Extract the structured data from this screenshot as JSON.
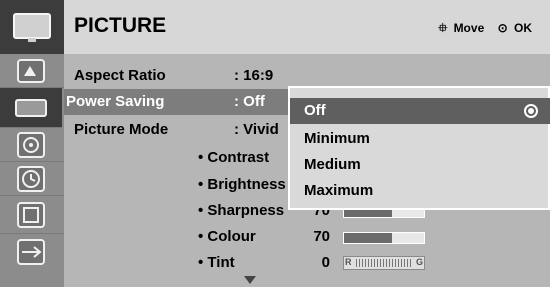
{
  "header": {
    "title": "PICTURE",
    "move_symbol": "⯐",
    "move_label": "Move",
    "ok_symbol": "⊙",
    "ok_label": "OK"
  },
  "sidebar": {
    "icons": [
      "picture-icon",
      "tv-icon",
      "audio-icon",
      "time-icon",
      "option-icon",
      "input-icon"
    ]
  },
  "menu": {
    "rows": [
      {
        "label": "Aspect Ratio",
        "value": ": 16:9"
      },
      {
        "label": "Power Saving",
        "value": ": Off"
      },
      {
        "label": "Picture Mode",
        "value": ": Vivid"
      }
    ],
    "sub_rows": [
      {
        "label": "• Contrast",
        "value": "",
        "level": null
      },
      {
        "label": "• Brightness",
        "value": "",
        "level": null
      },
      {
        "label": "• Sharpness",
        "value": "70",
        "level": 0.6
      },
      {
        "label": "• Colour",
        "value": "70",
        "level": 0.6
      },
      {
        "label": "• Tint",
        "value": "0",
        "tint_left": "R",
        "tint_right": "G"
      }
    ]
  },
  "dropdown": {
    "options": [
      "Off",
      "Minimum",
      "Medium",
      "Maximum"
    ],
    "selected": "Off"
  },
  "colors": {
    "selected_row": "#7d7d7d",
    "panel": "#b6b6b6"
  }
}
